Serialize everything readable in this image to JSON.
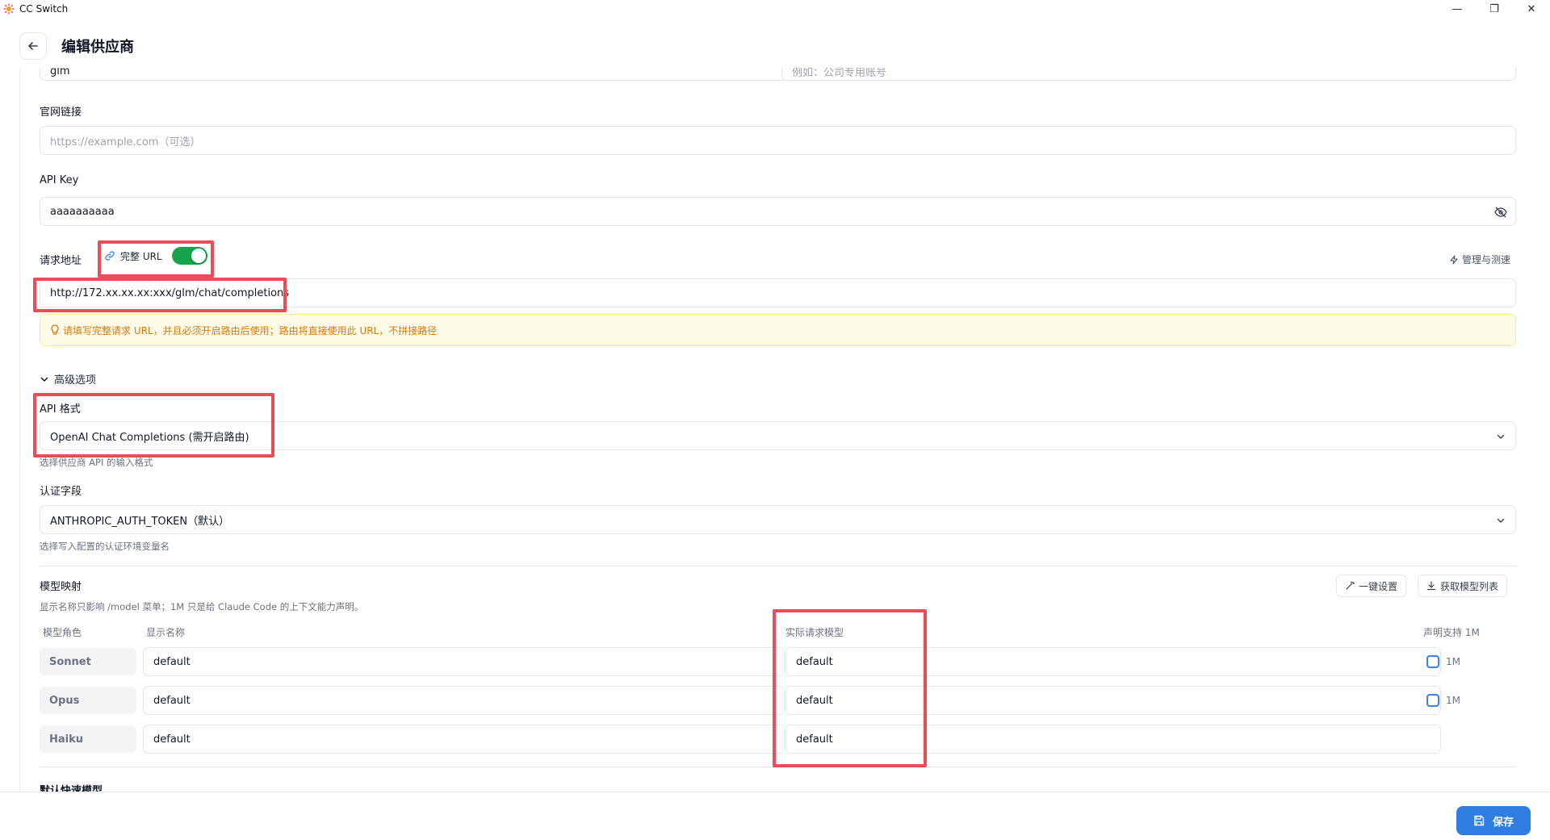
{
  "window": {
    "title": "CC Switch",
    "minimize": "—",
    "restore": "❐",
    "close": "✕"
  },
  "header": {
    "title": "编辑供应商"
  },
  "form": {
    "top_left_value": "glm",
    "top_right_placeholder": "例如：公司专用账号",
    "website_label": "官网链接",
    "website_placeholder": "https://example.com（可选）",
    "apikey_label": "API Key",
    "apikey_value": "aaaaaaaaaa",
    "endpoint_label": "请求地址",
    "full_url_label": "完整 URL",
    "full_url_enabled": true,
    "manage_test_label": "管理与测速",
    "endpoint_value": "http://172.xx.xx.xx:xxx/glm/chat/completions",
    "endpoint_warning": "请填写完整请求 URL，并且必须开启路由后使用；路由将直接使用此 URL，不拼接路径",
    "advanced_label": "高级选项",
    "api_format_label": "API 格式",
    "api_format_value": "OpenAI Chat Completions (需开启路由)",
    "api_format_hint": "选择供应商 API 的输入格式",
    "auth_field_label": "认证字段",
    "auth_field_value": "ANTHROPIC_AUTH_TOKEN（默认）",
    "auth_field_hint": "选择写入配置的认证环境变量名",
    "model_mapping_label": "模型映射",
    "model_mapping_hint": "显示名称只影响 /model 菜单；1M 只是给 Claude Code 的上下文能力声明。",
    "one_click_btn": "一键设置",
    "fetch_models_btn": "获取模型列表",
    "col_role": "模型角色",
    "col_display": "显示名称",
    "col_actual": "实际请求模型",
    "col_1m": "声明支持 1M",
    "rows": [
      {
        "role": "Sonnet",
        "display": "default",
        "actual": "default",
        "has_1m": true,
        "tag_1m": "1M"
      },
      {
        "role": "Opus",
        "display": "default",
        "actual": "default",
        "has_1m": true,
        "tag_1m": "1M"
      },
      {
        "role": "Haiku",
        "display": "default",
        "actual": "default",
        "has_1m": false,
        "tag_1m": ""
      }
    ],
    "default_model_label": "默认快速模型"
  },
  "footer": {
    "save_label": "保存"
  },
  "colors": {
    "accent": "#2f7de1",
    "toggle_on": "#16a34a",
    "highlight": "#ea4d57",
    "warning": "#d97706"
  }
}
